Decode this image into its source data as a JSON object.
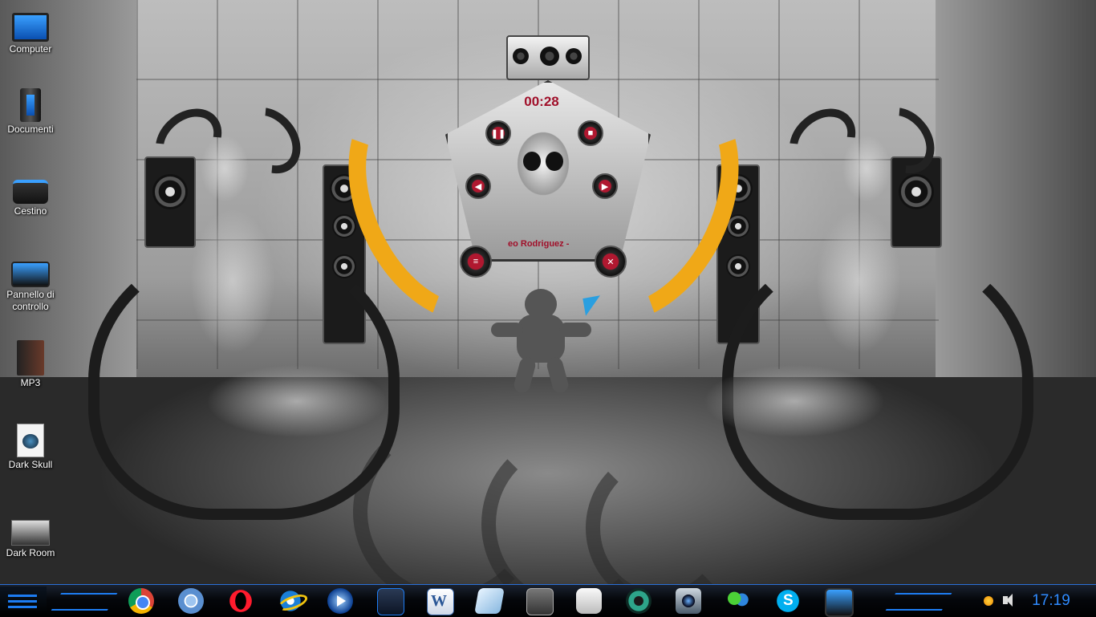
{
  "desktop": {
    "icons": [
      {
        "label": "Computer",
        "icon": "monitor-icon"
      },
      {
        "label": "Documenti",
        "icon": "documents-tower-icon"
      },
      {
        "label": "Cestino",
        "icon": "recycle-bin-icon"
      },
      {
        "label": "Pannello di controllo",
        "icon": "control-panel-icon"
      },
      {
        "label": "MP3",
        "icon": "mp3-folder-icon"
      },
      {
        "label": "Dark Skull",
        "icon": "image-file-icon"
      },
      {
        "label": "Dark Room",
        "icon": "dark-room-image-icon"
      }
    ]
  },
  "player": {
    "time": "00:28",
    "track": "eo Rodriguez -"
  },
  "taskbar": {
    "apps": [
      {
        "name": "google-chrome",
        "icon": "chrome-icon"
      },
      {
        "name": "chromium",
        "icon": "chromium-icon"
      },
      {
        "name": "opera",
        "icon": "opera-icon"
      },
      {
        "name": "internet-explorer",
        "icon": "ie-icon"
      },
      {
        "name": "media-player",
        "icon": "media-player-icon"
      },
      {
        "name": "file-manager",
        "icon": "blue-folder-icon"
      },
      {
        "name": "word",
        "icon": "word-icon"
      },
      {
        "name": "notes",
        "icon": "notes-icon"
      },
      {
        "name": "windows-switcher",
        "icon": "windows-icon"
      },
      {
        "name": "usb-device",
        "icon": "usb-icon"
      },
      {
        "name": "gear-app",
        "icon": "gear-icon"
      },
      {
        "name": "camera-app",
        "icon": "camera-icon"
      },
      {
        "name": "messenger",
        "icon": "messenger-icon"
      },
      {
        "name": "skype",
        "icon": "skype-icon"
      },
      {
        "name": "control-panel",
        "icon": "control-panel-icon"
      }
    ],
    "clock": "17:19"
  },
  "colors": {
    "accent": "#1d7cf2",
    "clock": "#2f8bff",
    "player_text": "#a0102a",
    "flame": "#f0a817"
  }
}
